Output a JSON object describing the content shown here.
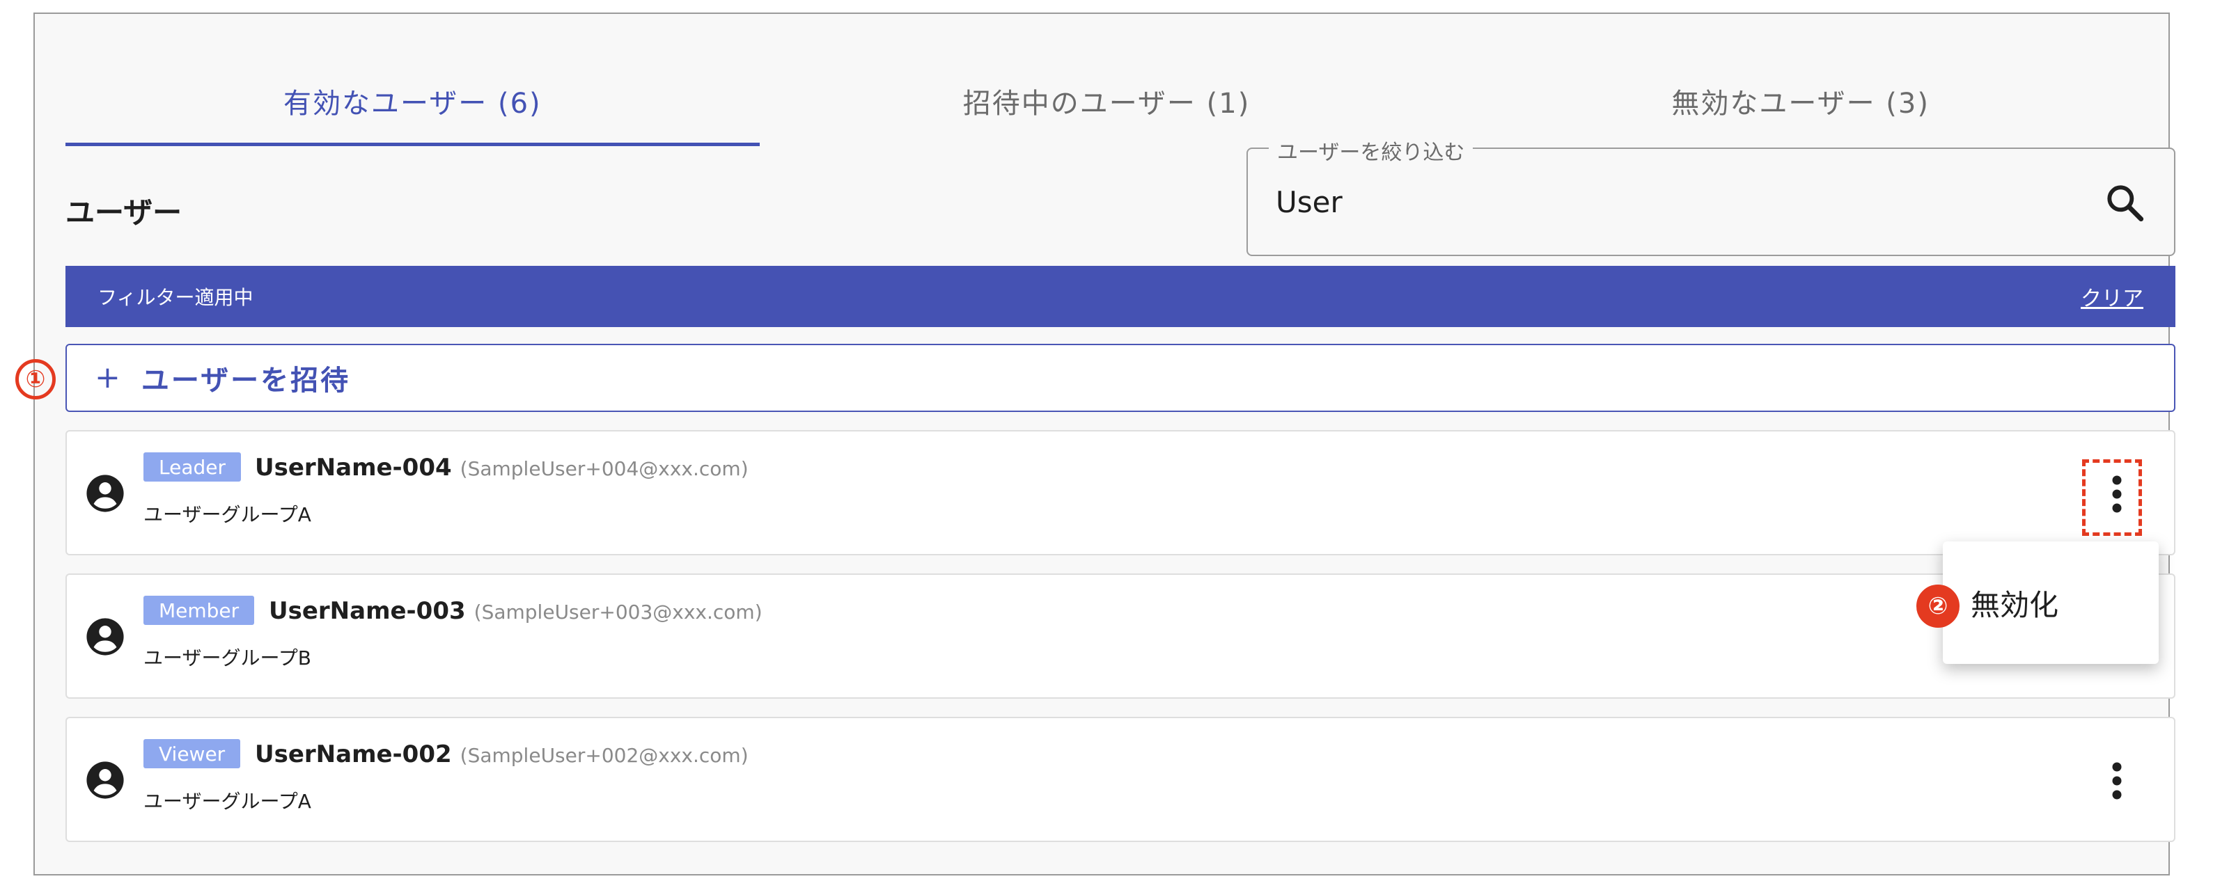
{
  "tabs": [
    {
      "label": "有効なユーザー (6)",
      "active": true
    },
    {
      "label": "招待中のユーザー (1)",
      "active": false
    },
    {
      "label": "無効なユーザー (3)",
      "active": false
    }
  ],
  "section": {
    "title": "ユーザー"
  },
  "search": {
    "label": "ユーザーを絞り込む",
    "value": "User",
    "icon": "search-icon"
  },
  "filter_bar": {
    "label": "フィルター適用中",
    "clear_label": "クリア",
    "color": "#4552b3"
  },
  "invite": {
    "plus": "+",
    "label": "ユーザーを招待"
  },
  "users": [
    {
      "role": "Leader",
      "name": "UserName-004",
      "email": "(SampleUser+004@xxx.com)",
      "group": "ユーザーグループA"
    },
    {
      "role": "Member",
      "name": "UserName-003",
      "email": "(SampleUser+003@xxx.com)",
      "group": "ユーザーグループB"
    },
    {
      "role": "Viewer",
      "name": "UserName-002",
      "email": "(SampleUser+002@xxx.com)",
      "group": "ユーザーグループA"
    }
  ],
  "menu": {
    "items": [
      {
        "label": "無効化"
      }
    ]
  },
  "annotations": {
    "marker_1": "①",
    "marker_2": "②"
  },
  "colors": {
    "accent": "#4352b4",
    "badge": "#8ea8ef",
    "annotation": "#e43a20"
  }
}
